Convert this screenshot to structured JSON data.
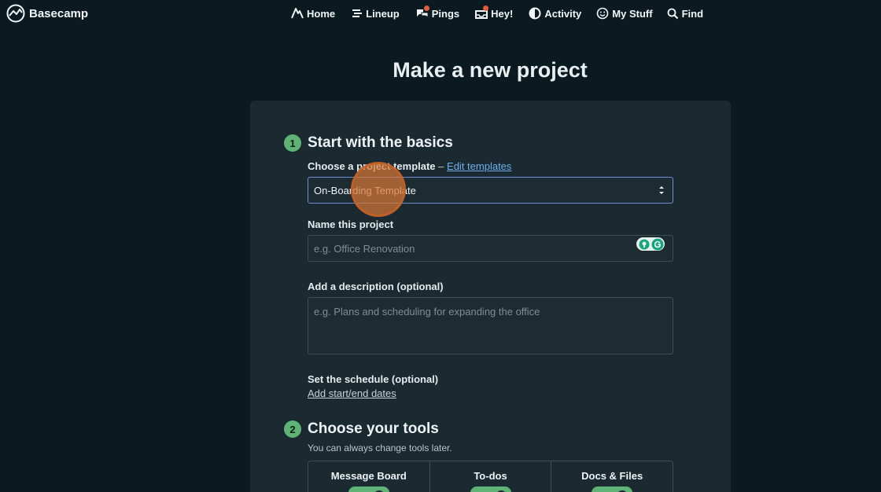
{
  "app": {
    "name": "Basecamp"
  },
  "nav": {
    "items": [
      {
        "label": "Home",
        "icon": "home-icon",
        "badge": false
      },
      {
        "label": "Lineup",
        "icon": "lineup-icon",
        "badge": false
      },
      {
        "label": "Pings",
        "icon": "chat-bubbles-icon",
        "badge": true
      },
      {
        "label": "Hey!",
        "icon": "inbox-icon",
        "badge": true
      },
      {
        "label": "Activity",
        "icon": "activity-icon",
        "badge": false
      },
      {
        "label": "My Stuff",
        "icon": "smiley-icon",
        "badge": false
      },
      {
        "label": "Find",
        "icon": "search-icon",
        "badge": false
      }
    ]
  },
  "page": {
    "title": "Make a new project"
  },
  "step1": {
    "number": "1",
    "heading": "Start with the basics",
    "template_label": "Choose a project template",
    "template_separator": "–",
    "edit_templates_link": "Edit templates",
    "template_selected": "On-Boarding Template",
    "name_label": "Name this project",
    "name_placeholder": "e.g. Office Renovation",
    "name_value": "",
    "description_label": "Add a description (optional)",
    "description_placeholder": "e.g. Plans and scheduling for expanding the office",
    "schedule_label": "Set the schedule (optional)",
    "schedule_link": "Add start/end dates"
  },
  "step2": {
    "number": "2",
    "heading": "Choose your tools",
    "subtext": "You can always change tools later.",
    "tools": [
      {
        "label": "Message Board",
        "enabled": true
      },
      {
        "label": "To-dos",
        "enabled": true
      },
      {
        "label": "Docs & Files",
        "enabled": true
      }
    ]
  },
  "colors": {
    "background": "#0b1a21",
    "card": "#1b2a31",
    "accent_green": "#5fb377",
    "link_blue": "#6eb0ee",
    "notification": "#e45c3f"
  }
}
